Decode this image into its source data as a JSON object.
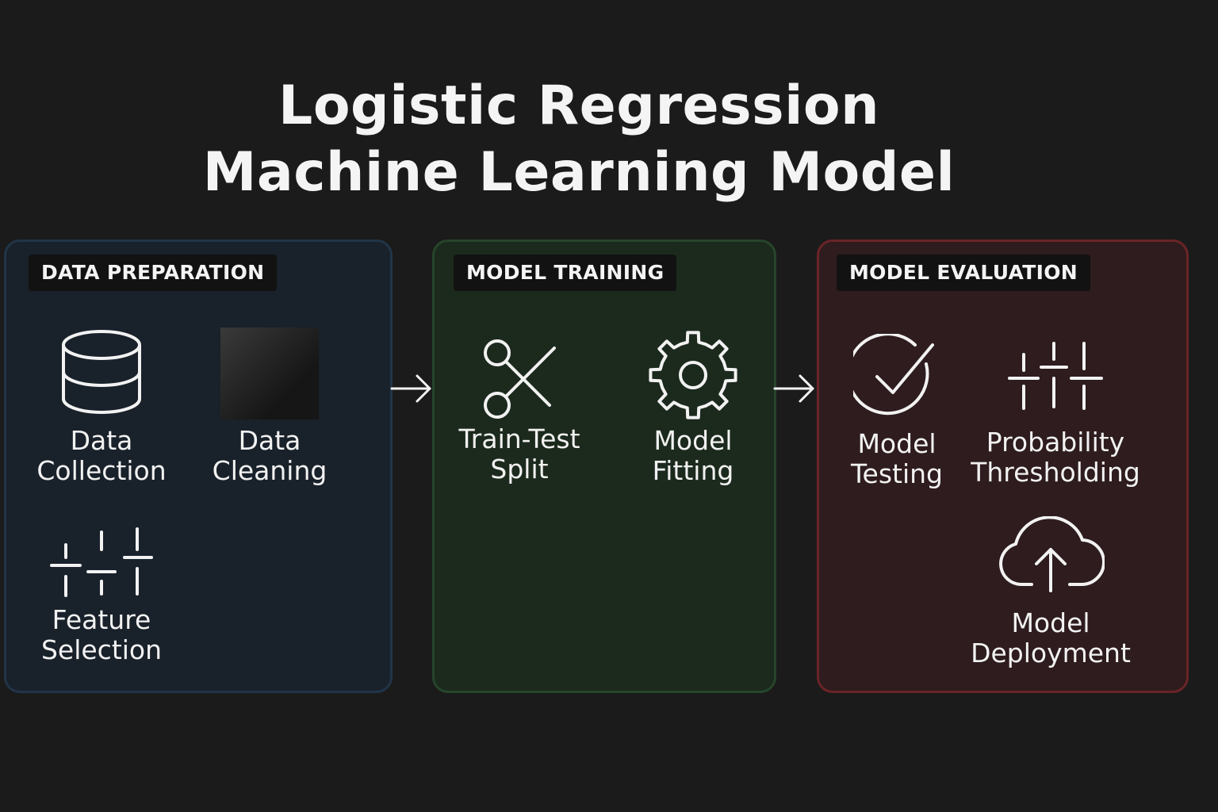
{
  "title": {
    "line1": "Logistic Regression",
    "line2": "Machine Learning Model"
  },
  "panels": [
    {
      "label": "DATA PREPARATION",
      "color": "#213548",
      "items": [
        {
          "label": "Data\nCollection",
          "icon": "database-icon"
        },
        {
          "label": "Data\nCleaning",
          "icon": "dark-square-icon"
        },
        {
          "label": "Feature\nSelection",
          "icon": "sliders-icon"
        }
      ]
    },
    {
      "label": "MODEL TRAINING",
      "color": "#26452b",
      "items": [
        {
          "label": "Train-Test\nSplit",
          "icon": "scissors-icon"
        },
        {
          "label": "Model\nFitting",
          "icon": "gear-icon"
        }
      ]
    },
    {
      "label": "MODEL EVALUATION",
      "color": "#6a2427",
      "items": [
        {
          "label": "Model\nTesting",
          "icon": "check-circle-icon"
        },
        {
          "label": "Probability\nThresholding",
          "icon": "sliders-icon"
        },
        {
          "label": "Model\nDeployment",
          "icon": "cloud-upload-icon"
        }
      ]
    }
  ],
  "arrows": [
    "arrow-right-icon",
    "arrow-right-icon"
  ]
}
